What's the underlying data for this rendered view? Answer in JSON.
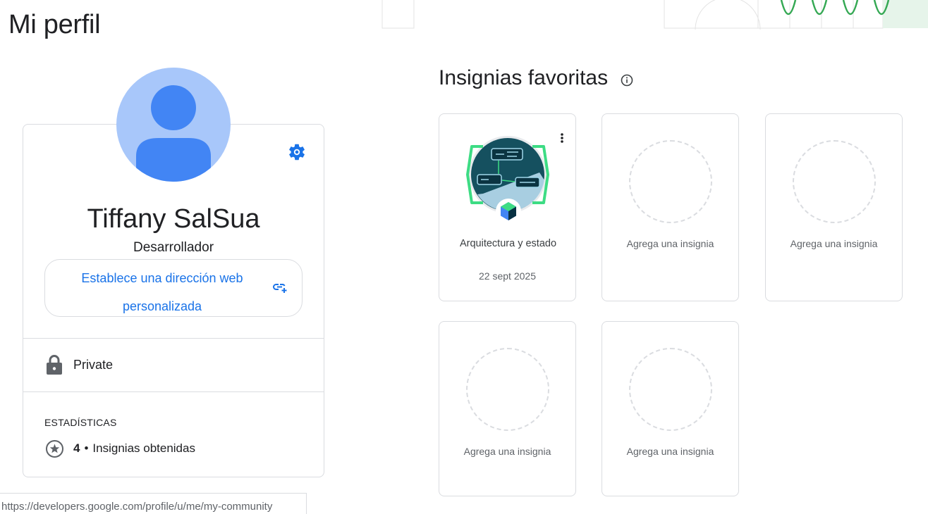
{
  "page": {
    "title": "Mi perfil"
  },
  "profile": {
    "name": "Tiffany SalSua",
    "role": "Desarrollador",
    "url_line1": "Establece una dirección web",
    "url_line2": "personalizada",
    "privacy": "Private",
    "stats_title": "ESTADÍSTICAS",
    "badges_count": "4",
    "badges_separator": "•",
    "badges_label": "Insignias obtenidas"
  },
  "badges": {
    "title": "Insignias favoritas",
    "items": [
      {
        "name": "Arquitectura y estado",
        "date": "22 sept 2025",
        "filled": true
      },
      {
        "label": "Agrega una insignia",
        "filled": false
      },
      {
        "label": "Agrega una insignia",
        "filled": false
      },
      {
        "label": "Agrega una insignia",
        "filled": false
      },
      {
        "label": "Agrega una insignia",
        "filled": false
      }
    ]
  },
  "status_bar": {
    "url": "https://developers.google.com/profile/u/me/my-community"
  },
  "icons": {
    "settings": "gear-icon",
    "custom_url": "add-link-icon",
    "privacy": "lock-icon",
    "badges_stat": "star-circle-icon",
    "info": "info-icon",
    "more": "more-vert-icon"
  },
  "colors": {
    "accent": "#1a73e8",
    "avatar_bg": "#a8c7fa",
    "avatar_fg": "#4285f4",
    "border": "#dadce0",
    "banner_green": "#34a853"
  }
}
